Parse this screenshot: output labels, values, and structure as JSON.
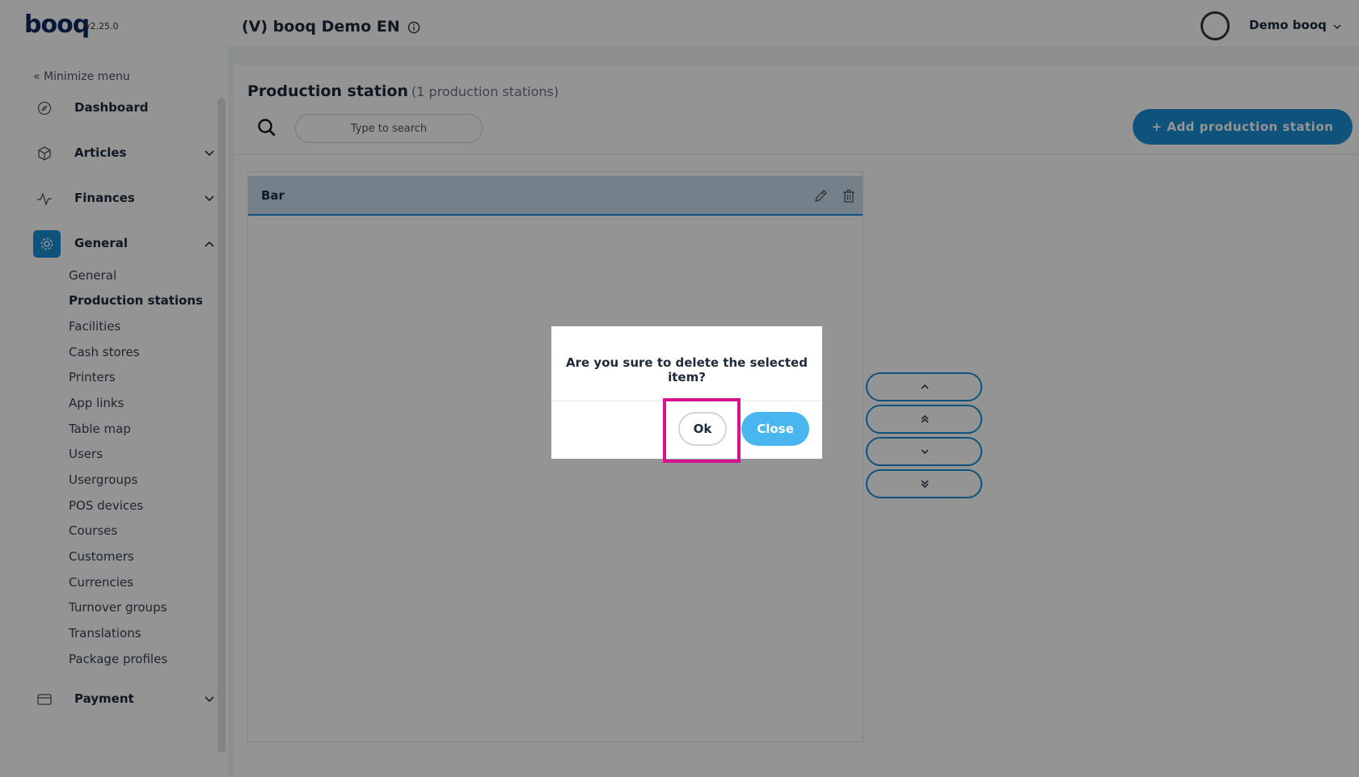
{
  "header": {
    "logo": "booq",
    "version": "v2.25.0",
    "venue_title": "(V) booq Demo EN",
    "user_name": "Demo booq"
  },
  "sidebar": {
    "minimize_label": "« Minimize menu",
    "top_items": [
      {
        "label": "Dashboard",
        "icon": "dashboard-icon"
      },
      {
        "label": "Articles",
        "icon": "box-icon"
      },
      {
        "label": "Finances",
        "icon": "pulse-icon"
      },
      {
        "label": "General",
        "icon": "gear-icon"
      },
      {
        "label": "Payment",
        "icon": "card-icon"
      }
    ],
    "general_sub": [
      "General",
      "Production stations",
      "Facilities",
      "Cash stores",
      "Printers",
      "App links",
      "Table map",
      "Users",
      "Usergroups",
      "POS devices",
      "Courses",
      "Customers",
      "Currencies",
      "Turnover groups",
      "Translations",
      "Package profiles"
    ],
    "active_sub": "Production stations"
  },
  "main": {
    "title": "Production station",
    "count_label": "(1 production stations)",
    "search_placeholder": "Type to search",
    "add_button_label": "+ Add production station",
    "rows": [
      {
        "label": "Bar"
      }
    ]
  },
  "dialog": {
    "message": "Are you sure to delete the selected item?",
    "ok_label": "Ok",
    "close_label": "Close"
  },
  "colors": {
    "accent": "#1b8fd6",
    "close_button": "#4ab6f0",
    "highlight": "#d6128f",
    "logo": "#0b2a5c"
  }
}
